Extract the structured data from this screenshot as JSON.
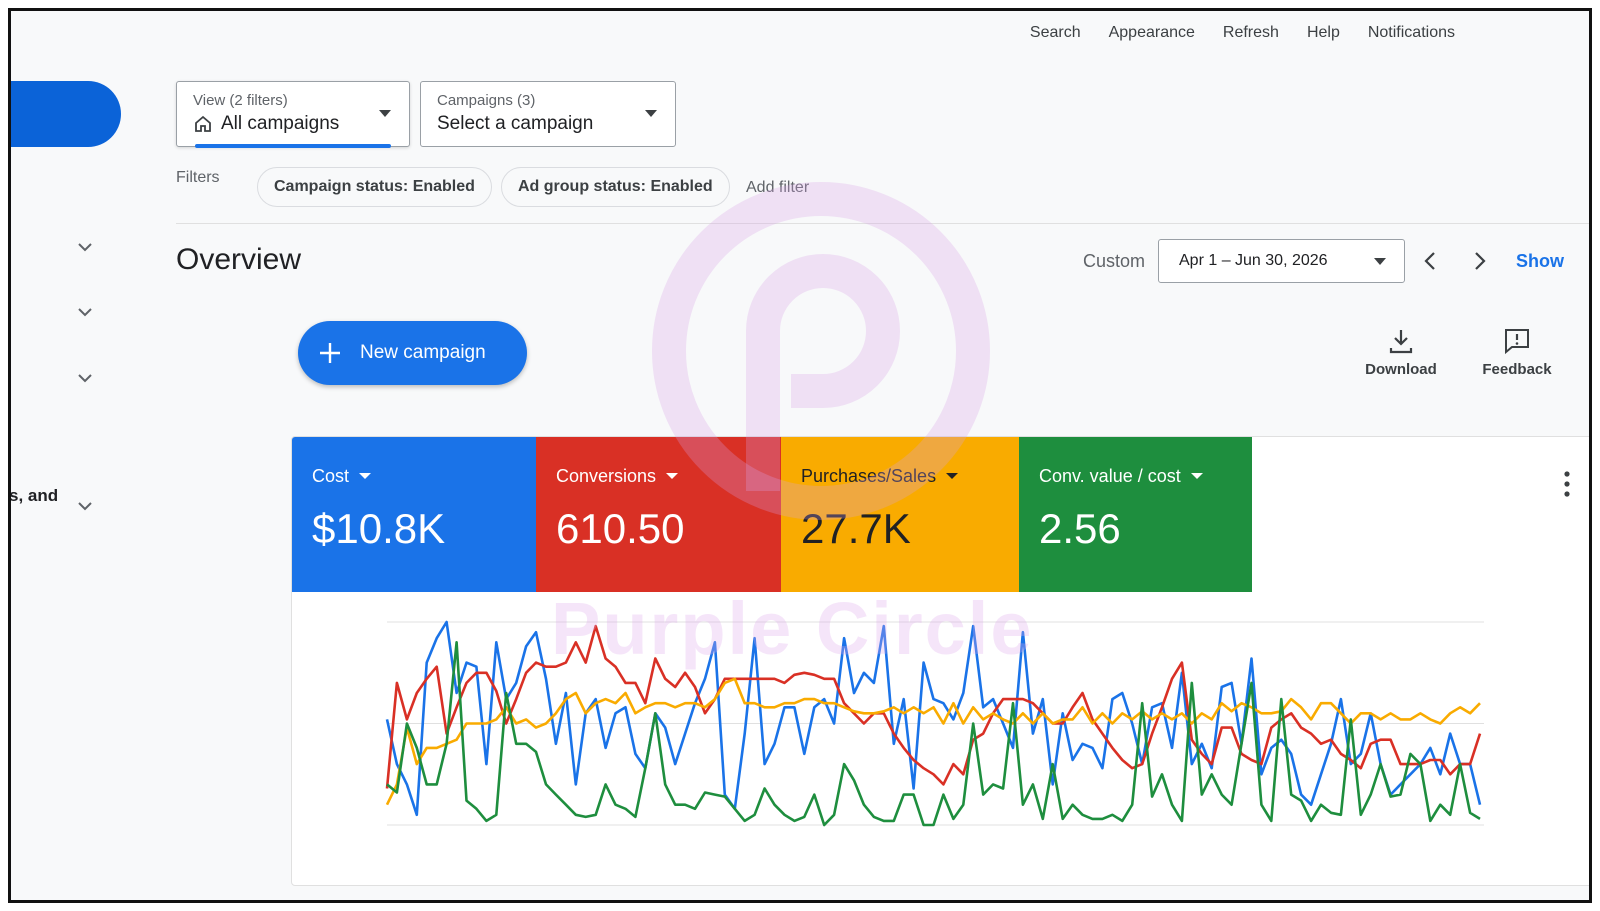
{
  "topnav": [
    "Search",
    "Appearance",
    "Refresh",
    "Help",
    "Notifications"
  ],
  "sidebar": {
    "partial_label": "s, and"
  },
  "view_selector": {
    "small": "View (2 filters)",
    "value": "All campaigns"
  },
  "campaign_selector": {
    "small": "Campaigns (3)",
    "value": "Select a campaign"
  },
  "filters": {
    "label": "Filters",
    "chips": [
      "Campaign status: Enabled",
      "Ad group status: Enabled"
    ],
    "add": "Add filter"
  },
  "overview": {
    "title": "Overview",
    "range_type": "Custom",
    "date_range": "Apr 1 – Jun 30, 2026",
    "show_link": "Show"
  },
  "actions": {
    "new_campaign": "New campaign",
    "download": "Download",
    "feedback": "Feedback"
  },
  "metrics": [
    {
      "label": "Cost",
      "value": "$10.8K",
      "color": "#1a73e8",
      "text_color": "#ffffff"
    },
    {
      "label": "Conversions",
      "value": "610.50",
      "color": "#d93025",
      "text_color": "#ffffff"
    },
    {
      "label": "Purchases/Sales",
      "value": "27.7K",
      "color": "#f9ab00",
      "text_color": "#202124"
    },
    {
      "label": "Conv. value / cost",
      "value": "2.56",
      "color": "#1e8e3e",
      "text_color": "#ffffff"
    }
  ],
  "watermark": "Purple Circle",
  "chart_data": {
    "type": "line",
    "ylim": [
      0,
      100
    ],
    "grid": true,
    "series": [
      {
        "color": "#1a73e8",
        "values": [
          52,
          30,
          20,
          5,
          80,
          92,
          100,
          65,
          80,
          78,
          30,
          90,
          62,
          70,
          88,
          95,
          72,
          40,
          65,
          20,
          55,
          62,
          38,
          55,
          58,
          35,
          28,
          55,
          48,
          30,
          45,
          60,
          72,
          90,
          15,
          8,
          45,
          92,
          30,
          40,
          58,
          58,
          35,
          58,
          62,
          50,
          92,
          65,
          75,
          70,
          98,
          40,
          62,
          18,
          80,
          62,
          60,
          52,
          65,
          98,
          58,
          62,
          50,
          38,
          95,
          45,
          62,
          20,
          55,
          32,
          40,
          38,
          28,
          62,
          65,
          50,
          30,
          58,
          60,
          38,
          75,
          30,
          40,
          28,
          68,
          70,
          40,
          82,
          25,
          38,
          42,
          35,
          15,
          10,
          25,
          40,
          62,
          30,
          35,
          55,
          30,
          15,
          20,
          25,
          30,
          38,
          25,
          45,
          30,
          30,
          10
        ]
      },
      {
        "color": "#d93025",
        "values": [
          18,
          70,
          52,
          65,
          72,
          78,
          45,
          58,
          70,
          75,
          75,
          66,
          50,
          62,
          75,
          80,
          78,
          78,
          80,
          90,
          80,
          98,
          82,
          78,
          70,
          70,
          60,
          82,
          72,
          68,
          75,
          68,
          55,
          62,
          72,
          72,
          72,
          72,
          72,
          72,
          70,
          74,
          75,
          74,
          72,
          72,
          60,
          55,
          50,
          55,
          55,
          45,
          38,
          32,
          28,
          25,
          20,
          30,
          25,
          42,
          45,
          55,
          62,
          62,
          62,
          60,
          55,
          50,
          50,
          58,
          65,
          52,
          45,
          38,
          32,
          28,
          30,
          45,
          58,
          72,
          80,
          42,
          35,
          30,
          48,
          48,
          35,
          32,
          30,
          48,
          52,
          55,
          48,
          45,
          40,
          42,
          35,
          32,
          28,
          40,
          42,
          42,
          30,
          30,
          30,
          32,
          32,
          25,
          30,
          30,
          45
        ]
      },
      {
        "color": "#f9ab00",
        "values": [
          10,
          20,
          48,
          30,
          38,
          38,
          40,
          42,
          50,
          50,
          50,
          52,
          58,
          50,
          52,
          48,
          50,
          55,
          62,
          65,
          55,
          60,
          62,
          60,
          65,
          55,
          58,
          60,
          60,
          58,
          60,
          60,
          58,
          62,
          70,
          72,
          60,
          60,
          58,
          58,
          60,
          60,
          62,
          62,
          60,
          60,
          58,
          56,
          55,
          55,
          56,
          58,
          55,
          58,
          55,
          58,
          50,
          60,
          50,
          58,
          52,
          55,
          52,
          50,
          55,
          50,
          55,
          50,
          52,
          52,
          58,
          50,
          55,
          50,
          55,
          52,
          56,
          52,
          55,
          52,
          55,
          50,
          55,
          52,
          60,
          56,
          60,
          58,
          55,
          55,
          56,
          62,
          58,
          52,
          60,
          60,
          55,
          50,
          55,
          55,
          52,
          55,
          52,
          52,
          55,
          52,
          50,
          55,
          58,
          55,
          60
        ]
      },
      {
        "color": "#1e8e3e",
        "values": [
          20,
          16,
          50,
          38,
          20,
          20,
          40,
          90,
          12,
          8,
          2,
          5,
          65,
          40,
          40,
          36,
          20,
          15,
          10,
          5,
          4,
          5,
          20,
          10,
          8,
          4,
          28,
          55,
          20,
          10,
          10,
          8,
          16,
          15,
          14,
          8,
          2,
          5,
          18,
          10,
          5,
          2,
          4,
          15,
          0,
          5,
          30,
          22,
          10,
          4,
          2,
          2,
          15,
          15,
          0,
          0,
          15,
          3,
          10,
          50,
          15,
          20,
          18,
          60,
          10,
          20,
          3,
          30,
          3,
          10,
          5,
          3,
          3,
          5,
          2,
          10,
          60,
          14,
          25,
          10,
          2,
          70,
          15,
          25,
          15,
          10,
          40,
          70,
          10,
          2,
          62,
          15,
          12,
          2,
          10,
          6,
          5,
          52,
          5,
          15,
          30,
          14,
          15,
          35,
          30,
          2,
          10,
          5,
          30,
          6,
          3
        ]
      }
    ]
  }
}
